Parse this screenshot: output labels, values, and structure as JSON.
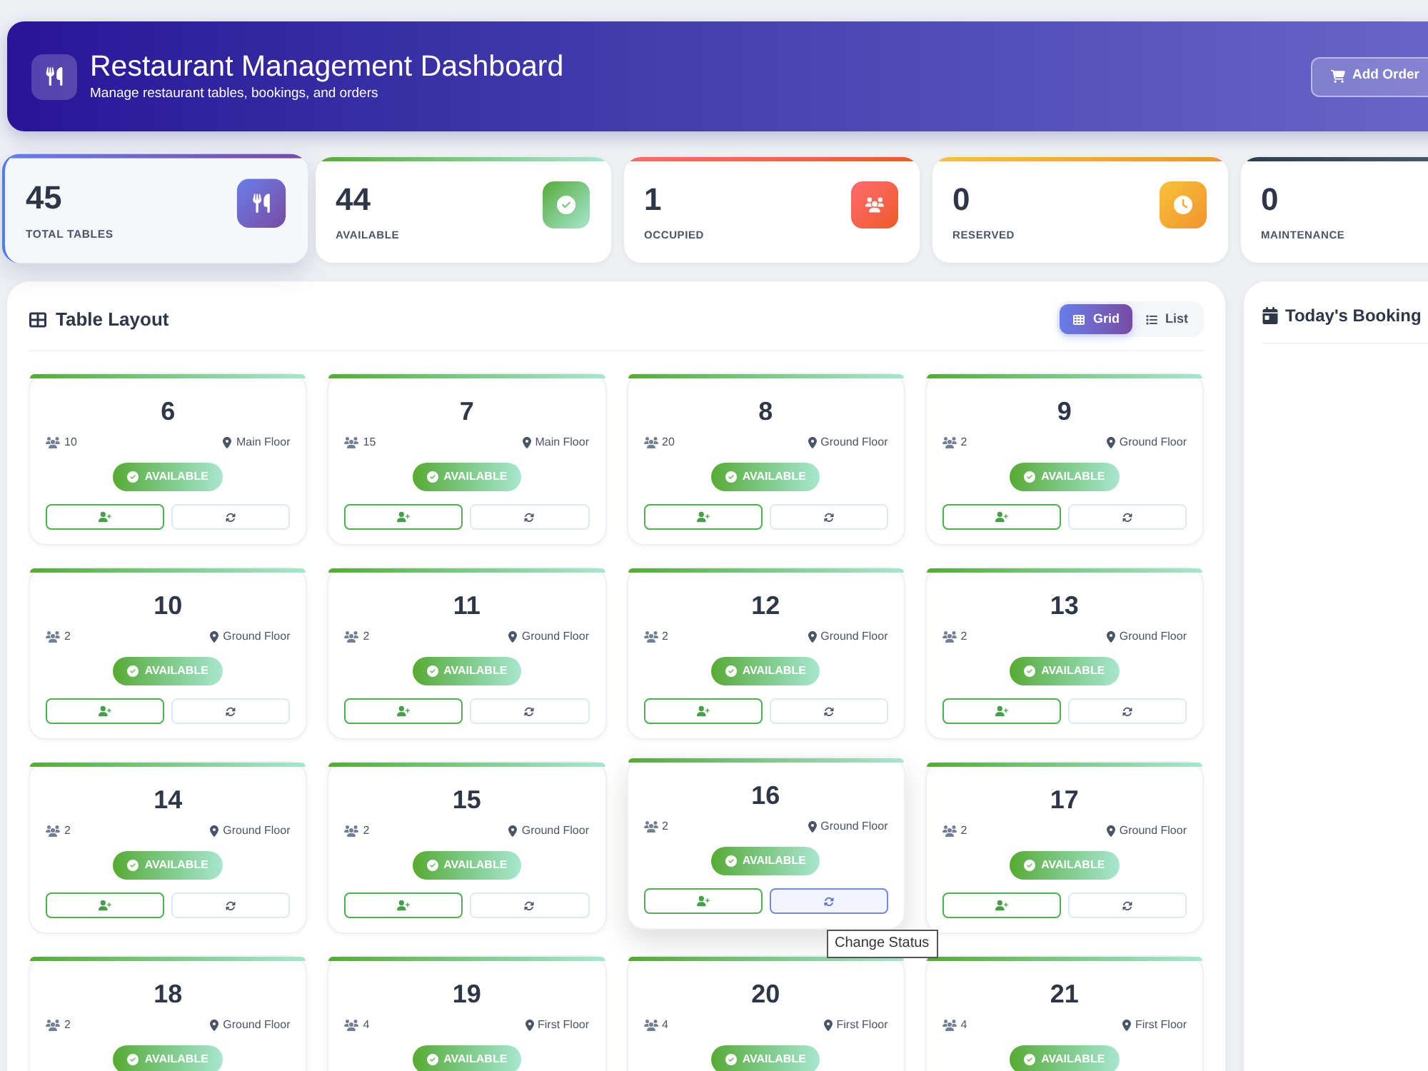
{
  "header": {
    "title": "Restaurant Management Dashboard",
    "subtitle": "Manage restaurant tables, bookings, and orders",
    "action": {
      "label": "Add Order"
    }
  },
  "stats": [
    {
      "kind": "total",
      "value": "45",
      "label": "TOTAL TABLES",
      "selected": true
    },
    {
      "kind": "available",
      "value": "44",
      "label": "AVAILABLE",
      "selected": false
    },
    {
      "kind": "occupied",
      "value": "1",
      "label": "OCCUPIED",
      "selected": false
    },
    {
      "kind": "reserved",
      "value": "0",
      "label": "RESERVED",
      "selected": false
    },
    {
      "kind": "maintenance",
      "value": "0",
      "label": "MAINTENANCE",
      "selected": false
    }
  ],
  "layout": {
    "title": "Table Layout",
    "view_toggle": [
      {
        "kind": "grid",
        "label": "Grid",
        "selected": true
      },
      {
        "kind": "list",
        "label": "List",
        "selected": false
      }
    ],
    "tables": [
      {
        "number": "6",
        "seats": "10",
        "location": "Main Floor",
        "status": {
          "kind": "available",
          "label": "AVAILABLE"
        },
        "hovered": false,
        "actions": [
          {
            "kind": "assign",
            "hovered": false
          },
          {
            "kind": "status",
            "hovered": false
          }
        ]
      },
      {
        "number": "7",
        "seats": "15",
        "location": "Main Floor",
        "status": {
          "kind": "available",
          "label": "AVAILABLE"
        },
        "hovered": false,
        "actions": [
          {
            "kind": "assign",
            "hovered": false
          },
          {
            "kind": "status",
            "hovered": false
          }
        ]
      },
      {
        "number": "8",
        "seats": "20",
        "location": "Ground Floor",
        "status": {
          "kind": "available",
          "label": "AVAILABLE"
        },
        "hovered": false,
        "actions": [
          {
            "kind": "assign",
            "hovered": false
          },
          {
            "kind": "status",
            "hovered": false
          }
        ]
      },
      {
        "number": "9",
        "seats": "2",
        "location": "Ground Floor",
        "status": {
          "kind": "available",
          "label": "AVAILABLE"
        },
        "hovered": false,
        "actions": [
          {
            "kind": "assign",
            "hovered": false
          },
          {
            "kind": "status",
            "hovered": false
          }
        ]
      },
      {
        "number": "10",
        "seats": "2",
        "location": "Ground Floor",
        "status": {
          "kind": "available",
          "label": "AVAILABLE"
        },
        "hovered": false,
        "actions": [
          {
            "kind": "assign",
            "hovered": false
          },
          {
            "kind": "status",
            "hovered": false
          }
        ]
      },
      {
        "number": "11",
        "seats": "2",
        "location": "Ground Floor",
        "status": {
          "kind": "available",
          "label": "AVAILABLE"
        },
        "hovered": false,
        "actions": [
          {
            "kind": "assign",
            "hovered": false
          },
          {
            "kind": "status",
            "hovered": false
          }
        ]
      },
      {
        "number": "12",
        "seats": "2",
        "location": "Ground Floor",
        "status": {
          "kind": "available",
          "label": "AVAILABLE"
        },
        "hovered": false,
        "actions": [
          {
            "kind": "assign",
            "hovered": false
          },
          {
            "kind": "status",
            "hovered": false
          }
        ]
      },
      {
        "number": "13",
        "seats": "2",
        "location": "Ground Floor",
        "status": {
          "kind": "available",
          "label": "AVAILABLE"
        },
        "hovered": false,
        "actions": [
          {
            "kind": "assign",
            "hovered": false
          },
          {
            "kind": "status",
            "hovered": false
          }
        ]
      },
      {
        "number": "14",
        "seats": "2",
        "location": "Ground Floor",
        "status": {
          "kind": "available",
          "label": "AVAILABLE"
        },
        "hovered": false,
        "actions": [
          {
            "kind": "assign",
            "hovered": false
          },
          {
            "kind": "status",
            "hovered": false
          }
        ]
      },
      {
        "number": "15",
        "seats": "2",
        "location": "Ground Floor",
        "status": {
          "kind": "available",
          "label": "AVAILABLE"
        },
        "hovered": false,
        "actions": [
          {
            "kind": "assign",
            "hovered": false
          },
          {
            "kind": "status",
            "hovered": false
          }
        ]
      },
      {
        "number": "16",
        "seats": "2",
        "location": "Ground Floor",
        "status": {
          "kind": "available",
          "label": "AVAILABLE"
        },
        "hovered": true,
        "tooltip": "Change Status",
        "actions": [
          {
            "kind": "assign",
            "hovered": false
          },
          {
            "kind": "status",
            "hovered": true
          }
        ]
      },
      {
        "number": "17",
        "seats": "2",
        "location": "Ground Floor",
        "status": {
          "kind": "available",
          "label": "AVAILABLE"
        },
        "hovered": false,
        "actions": [
          {
            "kind": "assign",
            "hovered": false
          },
          {
            "kind": "status",
            "hovered": false
          }
        ]
      },
      {
        "number": "18",
        "seats": "2",
        "location": "Ground Floor",
        "status": {
          "kind": "available",
          "label": "AVAILABLE"
        },
        "hovered": false
      },
      {
        "number": "19",
        "seats": "4",
        "location": "First Floor",
        "status": {
          "kind": "available",
          "label": "AVAILABLE"
        },
        "hovered": false
      },
      {
        "number": "20",
        "seats": "4",
        "location": "First Floor",
        "status": {
          "kind": "available",
          "label": "AVAILABLE"
        },
        "hovered": false
      },
      {
        "number": "21",
        "seats": "4",
        "location": "First Floor",
        "status": {
          "kind": "available",
          "label": "AVAILABLE"
        },
        "hovered": false
      }
    ]
  },
  "bookings": {
    "title": "Today's Booking"
  }
}
